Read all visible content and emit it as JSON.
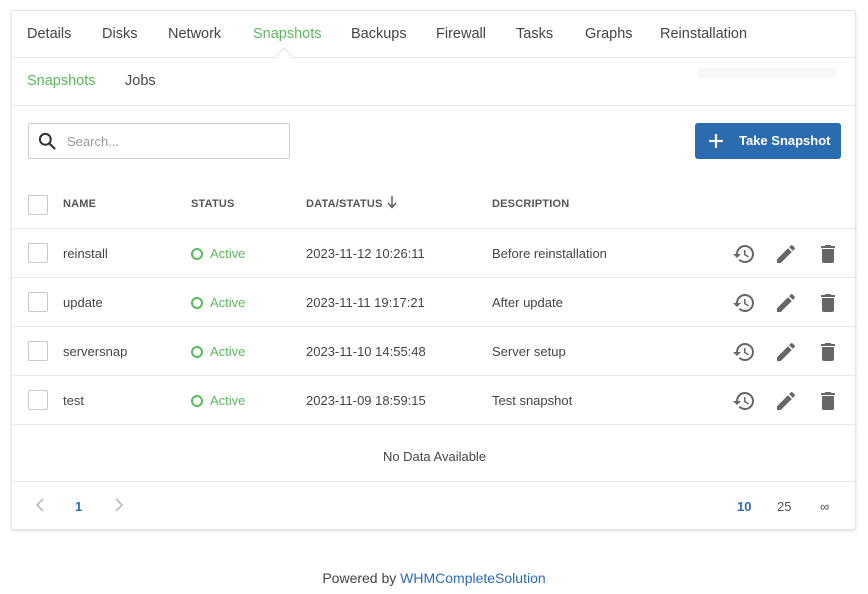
{
  "tabs": [
    {
      "label": "Details"
    },
    {
      "label": "Disks"
    },
    {
      "label": "Network"
    },
    {
      "label": "Snapshots",
      "active": true
    },
    {
      "label": "Backups"
    },
    {
      "label": "Firewall"
    },
    {
      "label": "Tasks"
    },
    {
      "label": "Graphs"
    },
    {
      "label": "Reinstallation"
    }
  ],
  "subtabs": [
    {
      "label": "Snapshots",
      "active": true
    },
    {
      "label": "Jobs"
    }
  ],
  "search": {
    "placeholder": "Search...",
    "value": ""
  },
  "take_snapshot": {
    "label": "Take Snapshot"
  },
  "table": {
    "columns": [
      "NAME",
      "STATUS",
      "DATA/STATUS",
      "DESCRIPTION"
    ],
    "rows": [
      {
        "name": "reinstall",
        "status": "Active",
        "date": "2023-11-12 10:26:11",
        "description": "Before reinstallation"
      },
      {
        "name": "update",
        "status": "Active",
        "date": "2023-11-11 19:17:21",
        "description": "After update"
      },
      {
        "name": "serversnap",
        "status": "Active",
        "date": "2023-11-10 14:55:48",
        "description": "Server setup"
      },
      {
        "name": "test",
        "status": "Active",
        "date": "2023-11-09 18:59:15",
        "description": "Test snapshot"
      }
    ],
    "empty_text": "No Data Available"
  },
  "pagination": {
    "current_page": "1",
    "page_sizes": [
      "10",
      "25",
      "∞"
    ],
    "active_size": "10"
  },
  "footer": {
    "prefix": "Powered by ",
    "link": "WHMCompleteSolution"
  },
  "colors": {
    "accent_green": "#5cb85c",
    "primary_blue": "#2b6cb0",
    "icon_gray": "#666666"
  },
  "icons": {
    "search": "search-icon",
    "plus": "plus-icon",
    "restore": "restore-icon",
    "edit": "pencil-icon",
    "delete": "trash-icon",
    "sort": "arrow-down-icon"
  }
}
